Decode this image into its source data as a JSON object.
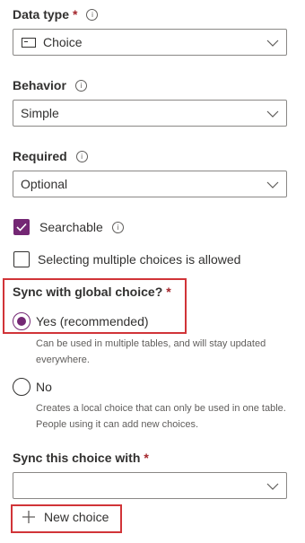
{
  "data_type": {
    "label": "Data type",
    "required_mark": "*",
    "value": "Choice",
    "icon": "choice-field-icon"
  },
  "behavior": {
    "label": "Behavior",
    "value": "Simple"
  },
  "required": {
    "label": "Required",
    "value": "Optional"
  },
  "searchable": {
    "label": "Searchable",
    "checked": true
  },
  "multiple": {
    "label": "Selecting multiple choices is allowed",
    "checked": false
  },
  "sync_global": {
    "label": "Sync with global choice?",
    "required_mark": "*",
    "options": [
      {
        "label": "Yes (recommended)",
        "selected": true,
        "description": "Can be used in multiple tables, and will stay updated everywhere."
      },
      {
        "label": "No",
        "selected": false,
        "description": "Creates a local choice that can only be used in one table. People using it can add new choices."
      }
    ]
  },
  "sync_this": {
    "label": "Sync this choice with",
    "required_mark": "*",
    "value": ""
  },
  "new_choice": {
    "label": "New choice"
  },
  "colors": {
    "accent": "#742774",
    "highlight": "#d13438",
    "required": "#a4262c"
  }
}
